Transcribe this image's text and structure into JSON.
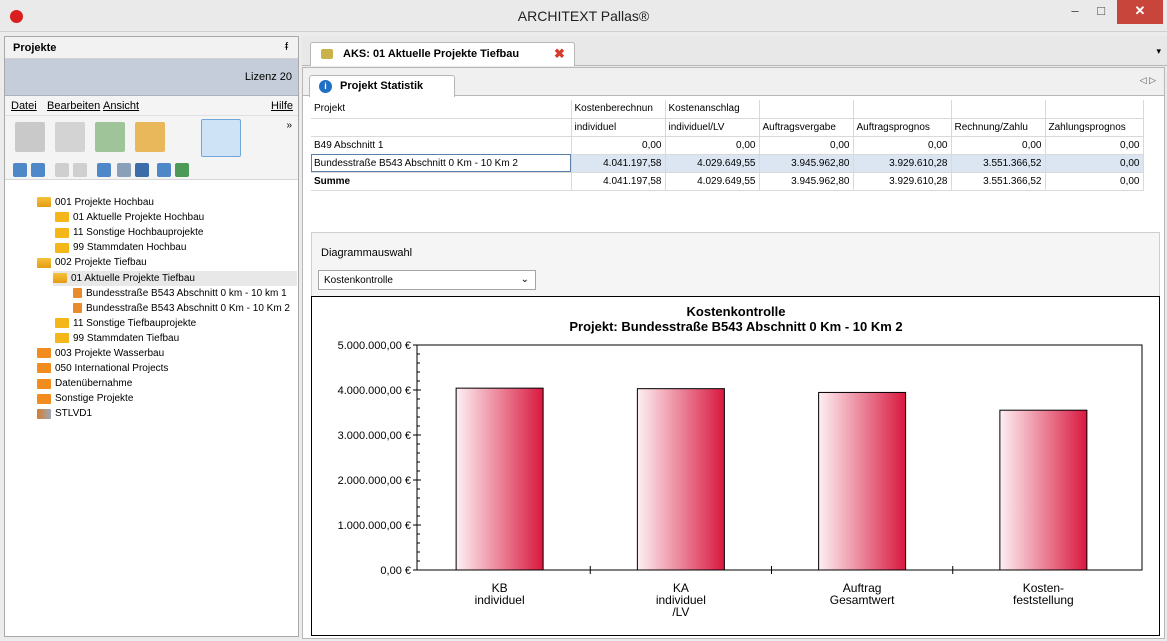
{
  "window": {
    "title": "ARCHITEXT Pallas®",
    "min": "–",
    "max": "□",
    "close": "✕"
  },
  "left_panel": {
    "title": "Projekte",
    "pin": "ᵮ",
    "lizenz": "Lizenz 20",
    "menu": [
      "Datei",
      "Bearbeiten",
      "Ansicht",
      "Hilfe"
    ],
    "tree": [
      {
        "label": "001 Projekte Hochbau",
        "level": 0,
        "icon": "folder-open-icon"
      },
      {
        "label": "01 Aktuelle Projekte Hochbau",
        "level": 1,
        "icon": "folder-icon"
      },
      {
        "label": "11 Sonstige Hochbauprojekte",
        "level": 1,
        "icon": "folder-icon"
      },
      {
        "label": "99 Stammdaten Hochbau",
        "level": 1,
        "icon": "folder-icon"
      },
      {
        "label": "002 Projekte Tiefbau",
        "level": 0,
        "icon": "folder-open-icon"
      },
      {
        "label": "01 Aktuelle Projekte Tiefbau",
        "level": 1,
        "icon": "folder-open-icon",
        "selected": true
      },
      {
        "label": "Bundesstraße B543 Abschnitt 0 km - 10 km 1",
        "level": 2,
        "icon": "project-icon"
      },
      {
        "label": "Bundesstraße B543 Abschnitt 0 Km - 10 Km 2",
        "level": 2,
        "icon": "project-icon"
      },
      {
        "label": "11 Sonstige Tiefbauprojekte",
        "level": 1,
        "icon": "folder-icon"
      },
      {
        "label": "99 Stammdaten Tiefbau",
        "level": 1,
        "icon": "folder-icon"
      },
      {
        "label": "003 Projekte Wasserbau",
        "level": 0,
        "icon": "folder-orange-icon"
      },
      {
        "label": "050 International Projects",
        "level": 0,
        "icon": "folder-orange-icon"
      },
      {
        "label": "Datenübernahme",
        "level": 0,
        "icon": "folder-orange-icon"
      },
      {
        "label": "Sonstige Projekte",
        "level": 0,
        "icon": "folder-orange-icon"
      },
      {
        "label": "STLVD1",
        "level": 0,
        "icon": "stlv-icon"
      }
    ]
  },
  "doc_tab": {
    "label": "AKS:  01 Aktuelle Projekte Tiefbau",
    "close": "✖",
    "arrow": "▾"
  },
  "inner_tab": {
    "label": "Projekt Statistik",
    "info": "i",
    "nav": "◁ ▷"
  },
  "table": {
    "header1": [
      "Projekt",
      "Kostenberechnun",
      "Kostenanschlag",
      "",
      "",
      "",
      ""
    ],
    "header2": [
      "",
      "individuel",
      "individuel/LV",
      "Auftragsvergabe",
      "Auftragsprognos",
      "Rechnung/Zahlu",
      "Zahlungsprognos"
    ],
    "rows": [
      [
        "B49 Abschnitt 1",
        "0,00",
        "0,00",
        "0,00",
        "0,00",
        "0,00",
        "0,00"
      ],
      [
        "Bundesstraße B543 Abschnitt 0 Km - 10 Km 2",
        "4.041.197,58",
        "4.029.649,55",
        "3.945.962,80",
        "3.929.610,28",
        "3.551.366,52",
        "0,00"
      ],
      [
        "Summe",
        "4.041.197,58",
        "4.029.649,55",
        "3.945.962,80",
        "3.929.610,28",
        "3.551.366,52",
        "0,00"
      ]
    ]
  },
  "diagram": {
    "label": "Diagrammauswahl",
    "selected": "Kostenkontrolle",
    "arrow": "⌄"
  },
  "chart_data": {
    "type": "bar",
    "title": "Kostenkontrolle",
    "subtitle": "Projekt: Bundesstraße B543 Abschnitt 0 Km - 10 Km 2",
    "categories": [
      [
        "KB",
        "individuel"
      ],
      [
        "KA",
        "individuel",
        "/LV"
      ],
      [
        "Auftrag",
        "Gesamtwert"
      ],
      [
        "Kosten-",
        "feststellung"
      ]
    ],
    "values": [
      4041197.58,
      4029649.55,
      3945962.8,
      3551366.52
    ],
    "yticks": [
      "0,00 €",
      "1.000.000,00 €",
      "2.000.000,00 €",
      "3.000.000,00 €",
      "4.000.000,00 €",
      "5.000.000,00 €"
    ],
    "ylim": [
      0,
      5000000
    ],
    "colors": {
      "bar_dark": "#d9183f",
      "bar_light": "#fdf0f3"
    }
  }
}
